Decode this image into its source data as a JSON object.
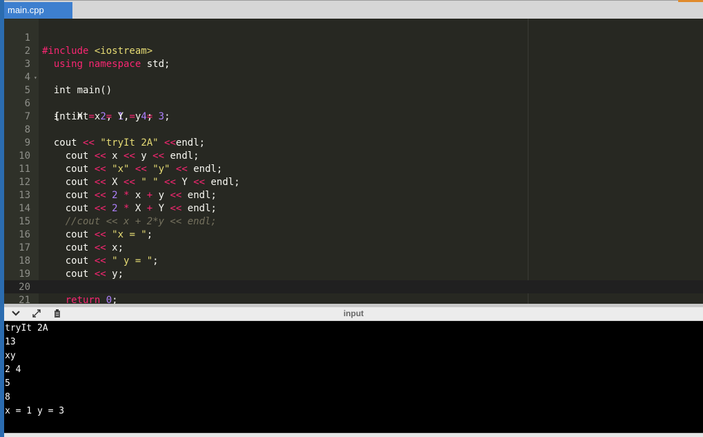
{
  "tabs": [
    {
      "label": "main.cpp"
    }
  ],
  "editor": {
    "lines": [
      {
        "num": "1",
        "code": "#include <iostream>"
      },
      {
        "num": "2",
        "code": "  using namespace std;"
      },
      {
        "num": "3",
        "code": ""
      },
      {
        "num": "4",
        "code": "  int main()"
      },
      {
        "num": "5",
        "code": "  {  int x = 1, y = 3;"
      },
      {
        "num": "6",
        "code": "  int X = 2, Y = 4;"
      },
      {
        "num": "7",
        "code": ""
      },
      {
        "num": "8",
        "code": "  cout << \"tryIt 2A\" <<endl;"
      },
      {
        "num": "9",
        "code": "    cout << x << y << endl;"
      },
      {
        "num": "10",
        "code": "    cout << \"x\" << \"y\" << endl;"
      },
      {
        "num": "11",
        "code": "    cout << X << \" \" << Y << endl;"
      },
      {
        "num": "12",
        "code": "    cout << 2 * x + y << endl;"
      },
      {
        "num": "13",
        "code": "    cout << 2 * X + Y << endl;"
      },
      {
        "num": "14",
        "code": "    //cout << x + 2*y << endl;"
      },
      {
        "num": "15",
        "code": "    cout << \"x = \";"
      },
      {
        "num": "16",
        "code": "    cout << x;"
      },
      {
        "num": "17",
        "code": "    cout << \" y = \";"
      },
      {
        "num": "18",
        "code": "    cout << y;"
      },
      {
        "num": "19",
        "code": ""
      },
      {
        "num": "20",
        "code": "    return 0;"
      },
      {
        "num": "21",
        "code": "    }"
      }
    ]
  },
  "panel": {
    "title": "input",
    "buttons": [
      {
        "icon": "chevron-down-icon"
      },
      {
        "icon": "expand-icon"
      },
      {
        "icon": "clipboard-icon"
      }
    ]
  },
  "console": {
    "output": [
      "tryIt 2A",
      "13",
      "xy",
      "2 4",
      "5",
      "8",
      "x = 1 y = 3"
    ]
  }
}
